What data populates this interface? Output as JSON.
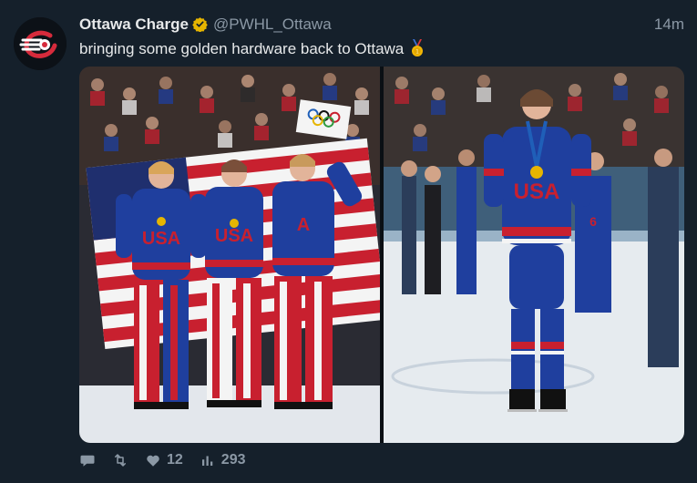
{
  "tweet": {
    "display_name": "Ottawa Charge",
    "handle": "@PWHL_Ottawa",
    "time": "14m",
    "text": "bringing some golden hardware back to Ottawa",
    "medal_emoji": "gold-medal-icon"
  },
  "actions": {
    "reply_icon": "reply-icon",
    "retweet_icon": "retweet-icon",
    "like_icon": "heart-icon",
    "like_count": "12",
    "views_icon": "bar-chart-icon",
    "view_count": "293"
  },
  "colors": {
    "background": "#15202b",
    "text": "#e7e9ea",
    "muted": "#8b98a5",
    "verified": "#e6b500",
    "usa_blue": "#1f3f9e",
    "usa_red": "#c8202f",
    "ice": "#e9eef3"
  }
}
